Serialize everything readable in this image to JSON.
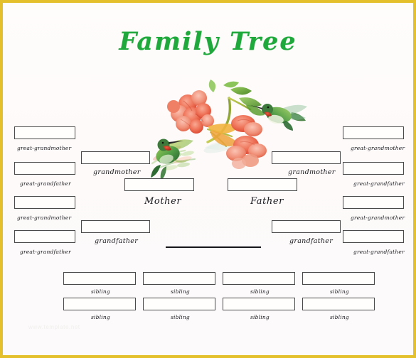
{
  "document": {
    "title": "Family Tree",
    "title_color": "#1FA83C",
    "border_color": "#E3C02C",
    "background_color": "#FDFBFA",
    "watermark": "www.template.net"
  },
  "artwork": {
    "name": "hummingbirds-and-trumpet-vine-watercolor",
    "flower_color": "#EC6A53",
    "flower_color_light": "#F2998B",
    "leaf_color": "#6FAE3E",
    "bird_body_color": "#4E9B46",
    "bird_throat_color": "#C8402E"
  },
  "labels": {
    "great_grandmother": "great-grandmother",
    "great_grandfather": "great-grandfather",
    "grandmother": "grandmother",
    "grandfather": "grandfather",
    "mother": "Mother",
    "father": "Father",
    "sibling": "sibling"
  },
  "boxes": {
    "left_great_grandparents": [
      {
        "label_key": "great_grandmother",
        "value": ""
      },
      {
        "label_key": "great_grandfather",
        "value": ""
      },
      {
        "label_key": "great_grandmother",
        "value": ""
      },
      {
        "label_key": "great_grandfather",
        "value": ""
      }
    ],
    "right_great_grandparents": [
      {
        "label_key": "great_grandmother",
        "value": ""
      },
      {
        "label_key": "great_grandfather",
        "value": ""
      },
      {
        "label_key": "great_grandmother",
        "value": ""
      },
      {
        "label_key": "great_grandfather",
        "value": ""
      }
    ],
    "left_grandparents": [
      {
        "label_key": "grandmother",
        "value": ""
      },
      {
        "label_key": "grandfather",
        "value": ""
      }
    ],
    "right_grandparents": [
      {
        "label_key": "grandmother",
        "value": ""
      },
      {
        "label_key": "grandfather",
        "value": ""
      }
    ],
    "parents": [
      {
        "label_key": "mother",
        "value": ""
      },
      {
        "label_key": "father",
        "value": ""
      }
    ],
    "siblings_row_1": [
      {
        "label_key": "sibling",
        "value": ""
      },
      {
        "label_key": "sibling",
        "value": ""
      },
      {
        "label_key": "sibling",
        "value": ""
      },
      {
        "label_key": "sibling",
        "value": ""
      }
    ],
    "siblings_row_2": [
      {
        "label_key": "sibling",
        "value": ""
      },
      {
        "label_key": "sibling",
        "value": ""
      },
      {
        "label_key": "sibling",
        "value": ""
      },
      {
        "label_key": "sibling",
        "value": ""
      }
    ]
  }
}
